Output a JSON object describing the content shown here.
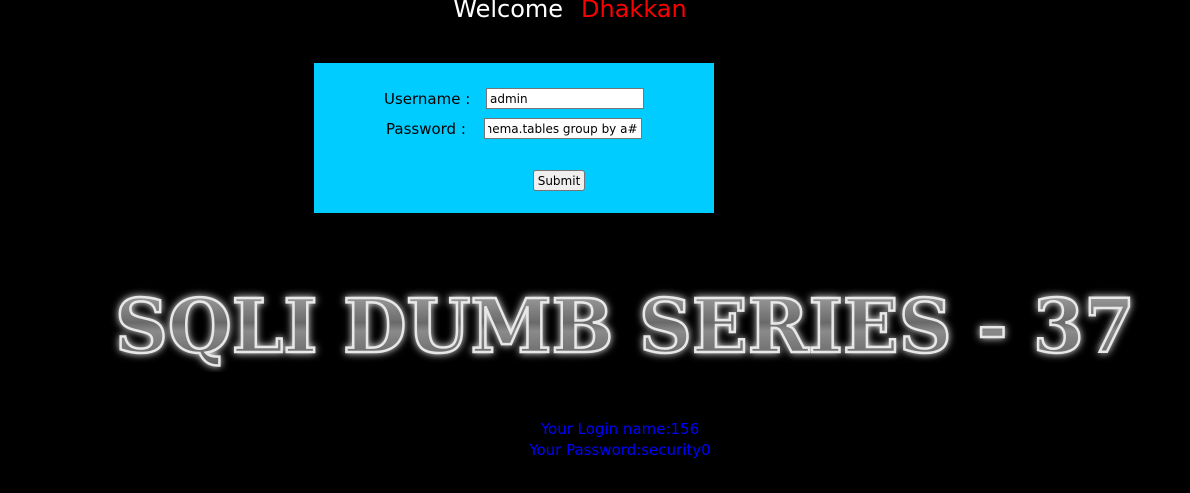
{
  "header": {
    "welcome_text": "Welcome",
    "name_text": "Dhakkan"
  },
  "login_form": {
    "username_label": "Username :",
    "username_value": "admin",
    "password_label": "Password :",
    "password_value": "chema.tables group by a#",
    "submit_label": "Submit"
  },
  "banner": {
    "text": "SQLI DUMB SERIES - 37"
  },
  "result": {
    "login_name_line": "Your Login name:156",
    "password_line": "Your Password:security0"
  },
  "colors": {
    "background": "#000000",
    "form_background": "#00ccff",
    "welcome": "#ffffff",
    "name": "#ff0000",
    "result_text": "#0000ff"
  }
}
